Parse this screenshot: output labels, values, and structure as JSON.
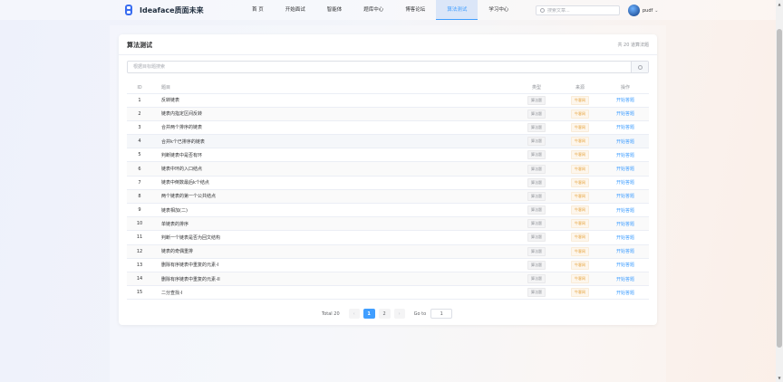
{
  "brand": {
    "name": "Ideaface质面未来"
  },
  "nav": {
    "items": [
      "首 页",
      "开始面试",
      "智能体",
      "题库中心",
      "博客论坛",
      "算法测试",
      "学习中心"
    ],
    "active_index": 5
  },
  "search": {
    "placeholder": "搜索文章..."
  },
  "user": {
    "name": "pudf"
  },
  "card": {
    "title": "算法测试",
    "count_text": "共 20 道算法题",
    "filter_placeholder": "根据目标题搜索"
  },
  "table": {
    "headers": {
      "id": "ID",
      "title": "题目",
      "type": "类型",
      "source": "来源",
      "op": "操作"
    },
    "rows": [
      {
        "id": "1",
        "title": "反转链表",
        "type": "算法题",
        "source": "牛客网",
        "op": "开始答题"
      },
      {
        "id": "2",
        "title": "链表内指定区间反转",
        "type": "算法题",
        "source": "牛客网",
        "op": "开始答题"
      },
      {
        "id": "3",
        "title": "合并两个排序的链表",
        "type": "算法题",
        "source": "牛客网",
        "op": "开始答题"
      },
      {
        "id": "4",
        "title": "合并k个已排序的链表",
        "type": "算法题",
        "source": "牛客网",
        "op": "开始答题"
      },
      {
        "id": "5",
        "title": "判断链表中是否有环",
        "type": "算法题",
        "source": "牛客网",
        "op": "开始答题"
      },
      {
        "id": "6",
        "title": "链表中环的入口结点",
        "type": "算法题",
        "source": "牛客网",
        "op": "开始答题"
      },
      {
        "id": "7",
        "title": "链表中倒数最后k个结点",
        "type": "算法题",
        "source": "牛客网",
        "op": "开始答题"
      },
      {
        "id": "8",
        "title": "两个链表的第一个公共结点",
        "type": "算法题",
        "source": "牛客网",
        "op": "开始答题"
      },
      {
        "id": "9",
        "title": "链表相加(二)",
        "type": "算法题",
        "source": "牛客网",
        "op": "开始答题"
      },
      {
        "id": "10",
        "title": "单链表的排序",
        "type": "算法题",
        "source": "牛客网",
        "op": "开始答题"
      },
      {
        "id": "11",
        "title": "判断一个链表是否为回文结构",
        "type": "算法题",
        "source": "牛客网",
        "op": "开始答题"
      },
      {
        "id": "12",
        "title": "链表的奇偶重排",
        "type": "算法题",
        "source": "牛客网",
        "op": "开始答题"
      },
      {
        "id": "13",
        "title": "删除有序链表中重复的元素-I",
        "type": "算法题",
        "source": "牛客网",
        "op": "开始答题"
      },
      {
        "id": "14",
        "title": "删除有序链表中重复的元素-II",
        "type": "算法题",
        "source": "牛客网",
        "op": "开始答题"
      },
      {
        "id": "15",
        "title": "二分查找-I",
        "type": "算法题",
        "source": "牛客网",
        "op": "开始答题"
      }
    ]
  },
  "pagination": {
    "total_text": "Total 20",
    "prev": "‹",
    "next": "›",
    "pages": [
      "1",
      "2"
    ],
    "current": "1",
    "goto_label": "Go to",
    "goto_value": "1"
  },
  "colors": {
    "accent": "#409eff",
    "source_tag": "#e6a23c"
  },
  "icons": {
    "search": "search-icon",
    "brand": "logo-icon",
    "chevron": "chevron-down-icon"
  }
}
